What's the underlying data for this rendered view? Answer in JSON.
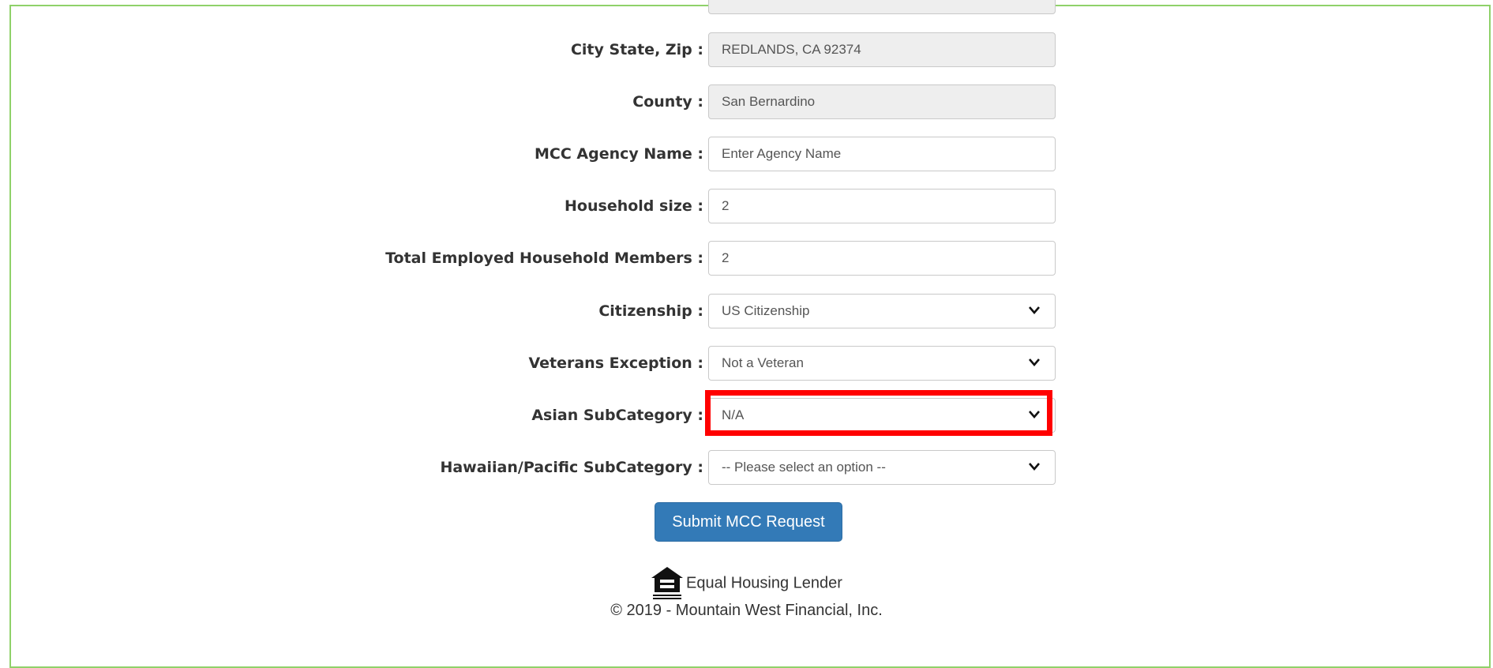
{
  "form": {
    "fields": [
      {
        "label": "City State, Zip :",
        "value": "REDLANDS, CA 92374",
        "type": "readonly"
      },
      {
        "label": "County :",
        "value": "San Bernardino",
        "type": "readonly"
      },
      {
        "label": "MCC Agency Name :",
        "value": "Enter Agency Name",
        "type": "input"
      },
      {
        "label": "Household size :",
        "value": "2",
        "type": "input"
      },
      {
        "label": "Total Employed Household Members :",
        "value": "2",
        "type": "input"
      },
      {
        "label": "Citizenship :",
        "value": "US Citizenship",
        "type": "select"
      },
      {
        "label": "Veterans Exception :",
        "value": "Not a Veteran",
        "type": "select"
      },
      {
        "label": "Asian SubCategory :",
        "value": "N/A",
        "type": "select",
        "highlighted": true
      },
      {
        "label": "Hawaiian/Pacific SubCategory :",
        "value": "-- Please select an option --",
        "type": "select"
      }
    ],
    "submit_label": "Submit MCC Request"
  },
  "footer": {
    "equal_housing_icon": "equal-housing-house-icon",
    "equal_housing_text": "Equal Housing Lender",
    "copyright": "© 2019 - Mountain West Financial, Inc."
  },
  "colors": {
    "frame_border": "#8fd16a",
    "button": "#337ab7",
    "highlight": "#ff0000"
  }
}
